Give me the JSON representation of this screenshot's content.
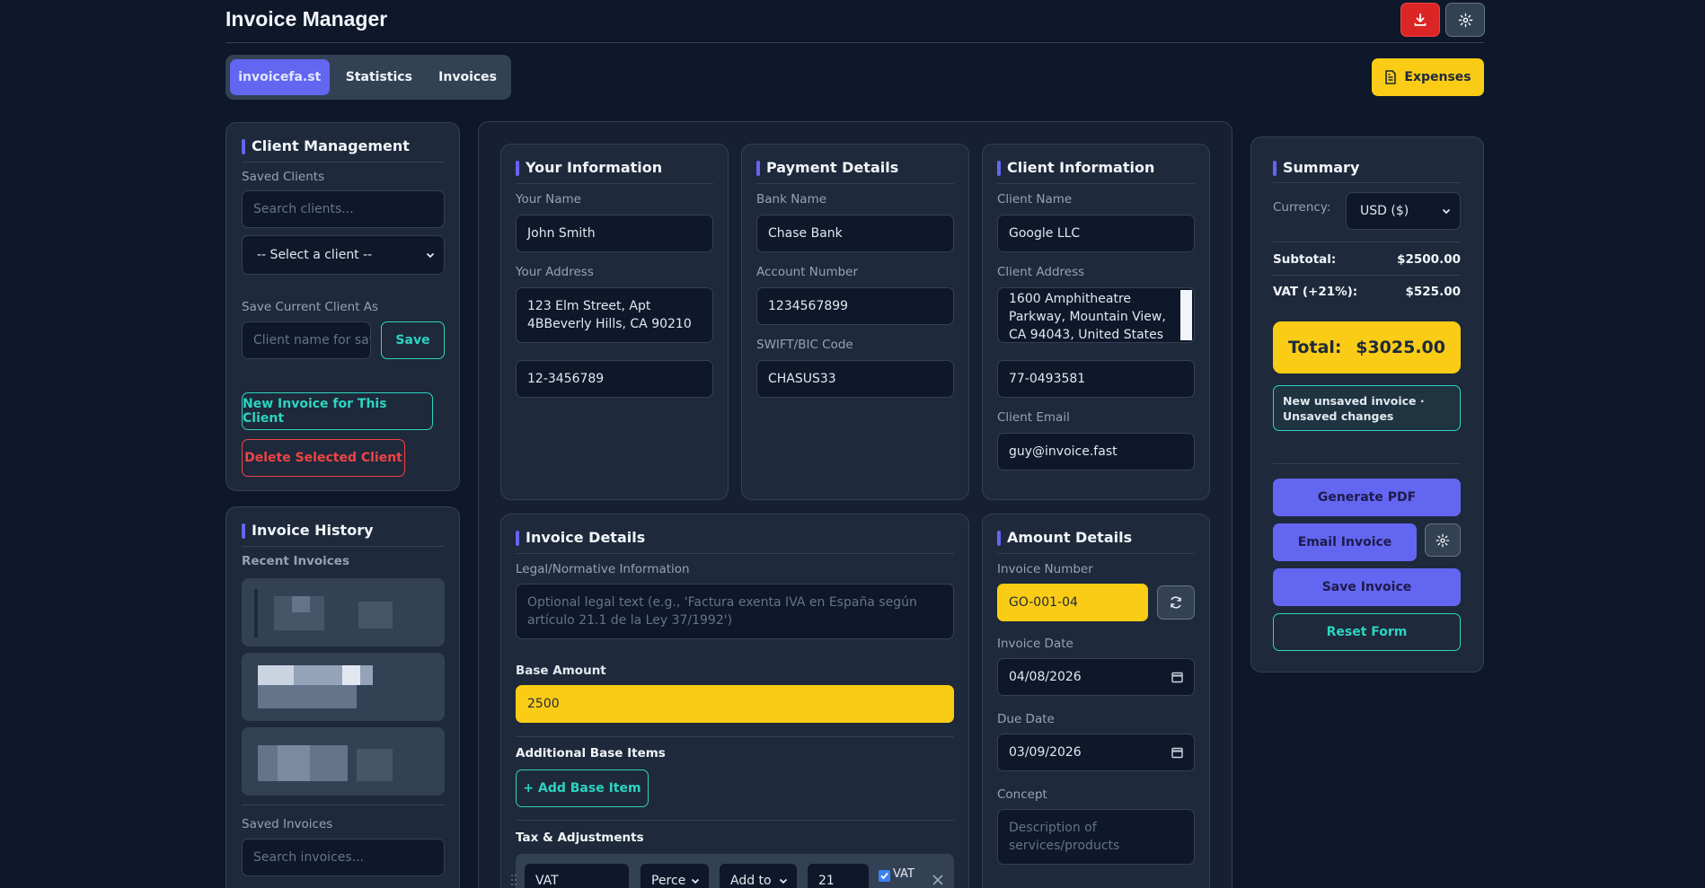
{
  "app": {
    "title": "Invoice Manager"
  },
  "icons": {
    "download": "download-icon",
    "settings": "gear-icon",
    "expenses": "document-icon",
    "refresh": "refresh-icon",
    "calendar": "calendar-icon",
    "close": "close-icon",
    "drag": "drag-handle-icon"
  },
  "colors": {
    "background": "#0f172a",
    "panel": "#1e293b",
    "accent": "#6366f1",
    "highlight": "#facc15",
    "teal": "#2dd4bf",
    "danger": "#ef4444"
  },
  "tabs": [
    {
      "label": "invoicefa.st",
      "active": true
    },
    {
      "label": "Statistics",
      "active": false
    },
    {
      "label": "Invoices",
      "active": false
    }
  ],
  "header": {
    "expenses_label": "Expenses"
  },
  "client_management": {
    "title": "Client Management",
    "saved_clients_label": "Saved Clients",
    "search_placeholder": "Search clients...",
    "select_value": "-- Select a client --",
    "save_as_label": "Save Current Client As",
    "save_as_placeholder": "Client name for saving",
    "save_label": "Save",
    "new_invoice_label": "New Invoice for This Client",
    "delete_label": "Delete Selected Client"
  },
  "invoice_history": {
    "title": "Invoice History",
    "recent_label": "Recent Invoices",
    "saved_label": "Saved Invoices",
    "search_placeholder": "Search invoices..."
  },
  "your_info": {
    "title": "Your Information",
    "name_label": "Your Name",
    "name_value": "John Smith",
    "address_label": "Your Address",
    "address_value": "123 Elm Street, Apt 4BBeverly Hills, CA 90210",
    "tax_id_value": "12-3456789"
  },
  "payment": {
    "title": "Payment Details",
    "bank_label": "Bank Name",
    "bank_value": "Chase Bank",
    "account_label": "Account Number",
    "account_value": "1234567899",
    "swift_label": "SWIFT/BIC Code",
    "swift_value": "CHASUS33"
  },
  "client_info": {
    "title": "Client Information",
    "name_label": "Client Name",
    "name_value": "Google LLC",
    "address_label": "Client Address",
    "address_value": "1600 Amphitheatre Parkway, Mountain View, CA 94043, United States",
    "tax_id_value": "77-0493581",
    "email_label": "Client Email",
    "email_value": "guy@invoice.fast"
  },
  "invoice_details": {
    "title": "Invoice Details",
    "legal_label": "Legal/Normative Information",
    "legal_placeholder": "Optional legal text (e.g., 'Factura exenta IVA en España según artículo 21.1 de la Ley 37/1992')",
    "base_label": "Base Amount",
    "base_value": "2500",
    "additional_label": "Additional Base Items",
    "add_item_label": "+ Add Base Item",
    "tax_label": "Tax & Adjustments",
    "tax_row": {
      "name": "VAT",
      "type": "Perce",
      "mode": "Add to",
      "value": "21",
      "checkbox_label": "VAT",
      "checked": true
    }
  },
  "amount_details": {
    "title": "Amount Details",
    "number_label": "Invoice Number",
    "number_value": "GO-001-04",
    "date_label": "Invoice Date",
    "date_value": "04/08/2026",
    "due_label": "Due Date",
    "due_value": "03/09/2026",
    "concept_label": "Concept",
    "concept_placeholder": "Description of services/products"
  },
  "summary": {
    "title": "Summary",
    "currency_label": "Currency:",
    "currency_value": "USD ($)",
    "subtotal_label": "Subtotal:",
    "subtotal_value": "$2500.00",
    "vat_label": "VAT (+21%):",
    "vat_value": "$525.00",
    "total_label": "Total:",
    "total_value": "$3025.00",
    "status": "New unsaved invoice · Unsaved changes",
    "generate_pdf": "Generate PDF",
    "email_invoice": "Email Invoice",
    "save_invoice": "Save Invoice",
    "reset_form": "Reset Form"
  }
}
